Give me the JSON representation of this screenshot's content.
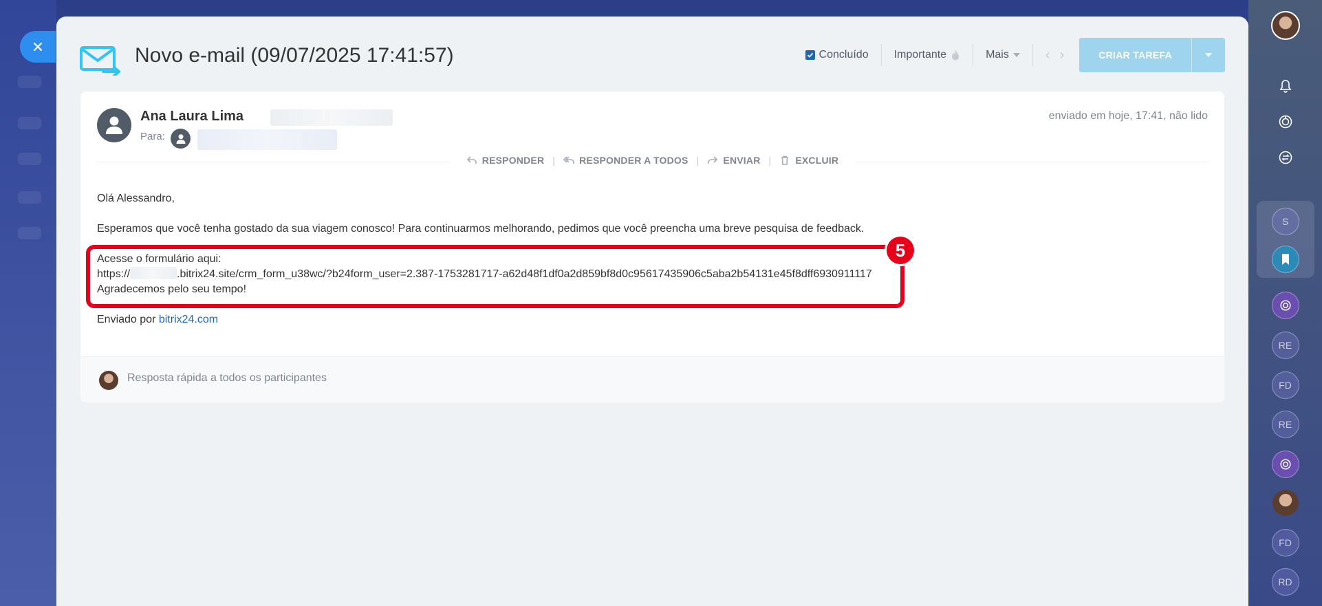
{
  "window": {
    "close_label": "×"
  },
  "header": {
    "title": "Novo e-mail (09/07/2025 17:41:57)",
    "done_label": "Concluído",
    "important_label": "Importante",
    "more_label": "Mais",
    "create_task_label": "CRIAR TAREFA"
  },
  "email": {
    "sender_name": "Ana Laura Lima",
    "to_label": "Para:",
    "sent_info": "enviado em hoje, 17:41, não lido",
    "actions": {
      "reply": "RESPONDER",
      "reply_all": "RESPONDER A TODOS",
      "forward": "ENVIAR",
      "delete": "EXCLUIR"
    },
    "greeting": "Olá Alessandro,",
    "paragraph": "Esperamos que você tenha gostado da sua viagem conosco! Para continuarmos melhorando, pedimos que você preencha uma breve pesquisa de feedback.",
    "form_line": "Acesse o formulário aqui:",
    "url_prefix": "https://",
    "url_rest": ".bitrix24.site/crm_form_u38wc/?b24form_user=2.387-1753281717-a62d48f1df0a2d859bf8d0c95617435906c5aba2b54131e45f8dff6930911117",
    "thanks": "Agradecemos pelo seu tempo!",
    "sent_by": "Enviado por",
    "sent_by_link": "bitrix24.com"
  },
  "annotation": {
    "badge_number": "5"
  },
  "reply": {
    "placeholder": "Resposta rápida a todos os participantes"
  },
  "rightbar": {
    "items": [
      "S",
      "RE",
      "FD",
      "RE",
      "FD",
      "RD"
    ]
  },
  "colors": {
    "accent": "#2067b0",
    "highlight": "#e6001a",
    "task_button": "#9fd4ef"
  }
}
